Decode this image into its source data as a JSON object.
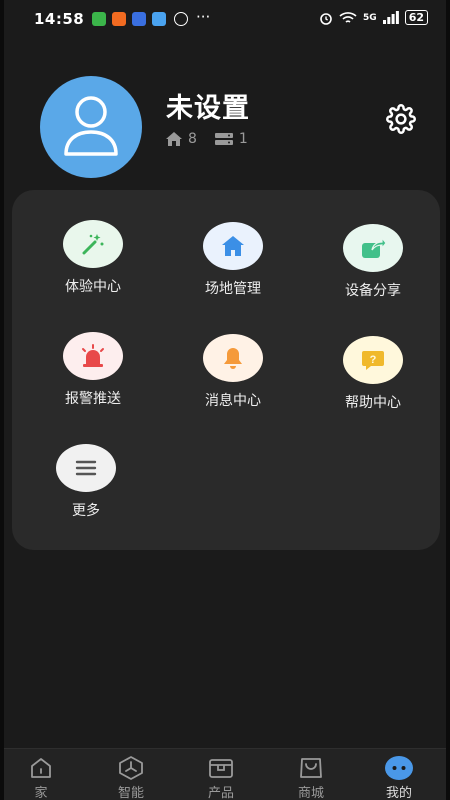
{
  "status_bar": {
    "time": "14:58",
    "network": "5G",
    "battery": "62",
    "more": "···"
  },
  "profile": {
    "name": "未设置",
    "home_count": "8",
    "device_count": "1"
  },
  "menu": {
    "items": [
      {
        "label": "体验中心",
        "icon": "magic-wand-icon",
        "bg": "#e9f7ec",
        "fg": "#3cb55a"
      },
      {
        "label": "场地管理",
        "icon": "home-icon",
        "bg": "#eaf2fd",
        "fg": "#3b8fe6"
      },
      {
        "label": "设备分享",
        "icon": "share-icon",
        "bg": "#e8f7ef",
        "fg": "#42c08a"
      },
      {
        "label": "报警推送",
        "icon": "alarm-light-icon",
        "bg": "#fdeeee",
        "fg": "#e8494a"
      },
      {
        "label": "消息中心",
        "icon": "bell-icon",
        "bg": "#fff2e6",
        "fg": "#f59a3a"
      },
      {
        "label": "帮助中心",
        "icon": "help-icon",
        "bg": "#fff8dc",
        "fg": "#f0b92c"
      },
      {
        "label": "更多",
        "icon": "menu-lines-icon",
        "bg": "#f1f1f1",
        "fg": "#555555"
      }
    ]
  },
  "tabbar": {
    "tabs": [
      {
        "label": "家"
      },
      {
        "label": "智能"
      },
      {
        "label": "产品"
      },
      {
        "label": "商城"
      },
      {
        "label": "我的"
      }
    ],
    "accent": "#4a98e8"
  }
}
